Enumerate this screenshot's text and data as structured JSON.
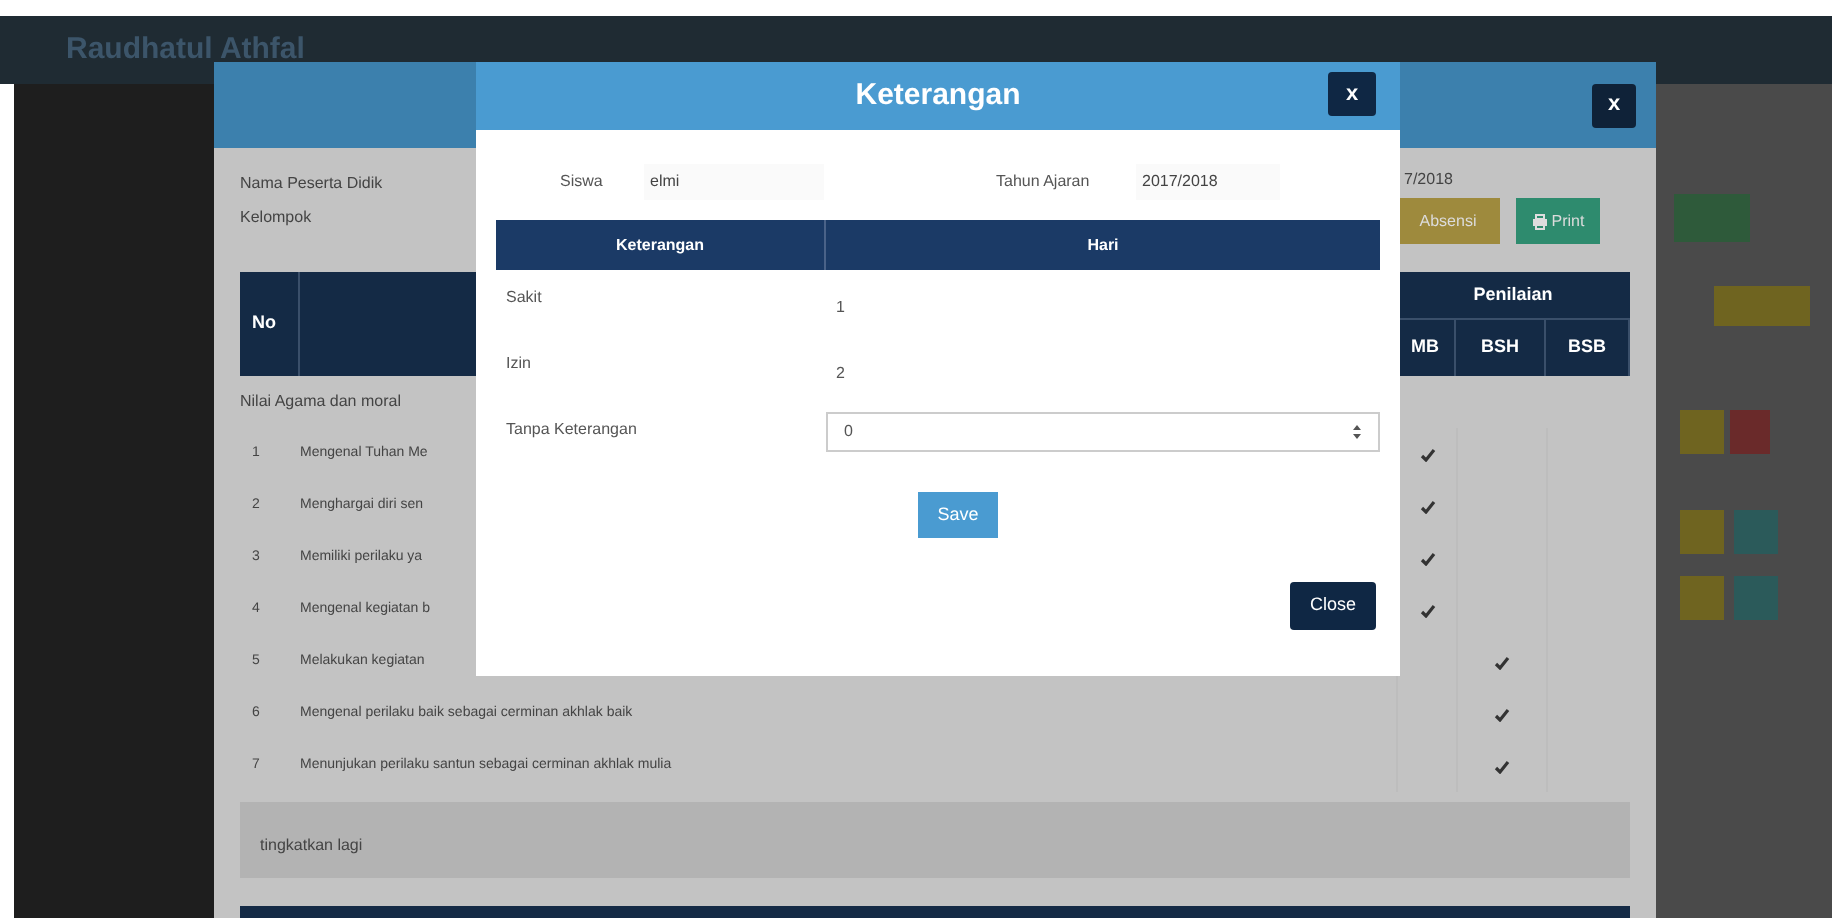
{
  "app": {
    "brand": "Raudhatul Athfal"
  },
  "report_modal": {
    "student_label": "Nama Peserta Didik",
    "group_label": "Kelompok",
    "year_fragment": "7/2018",
    "buttons": [
      {
        "kind": "attendance",
        "label": "Absensi"
      },
      {
        "kind": "print",
        "label": "Print"
      }
    ],
    "table": {
      "no_header": "No",
      "rating_group": "Penilaian",
      "rating_columns": [
        "MB",
        "BSH",
        "BSB"
      ],
      "section": "Nilai Agama dan moral",
      "rows": [
        {
          "no": "1",
          "text": "Mengenal Tuhan Me",
          "checks": [
            true,
            false,
            false
          ]
        },
        {
          "no": "2",
          "text": "Menghargai diri sen",
          "checks": [
            true,
            false,
            false
          ]
        },
        {
          "no": "3",
          "text": "Memiliki perilaku ya",
          "checks": [
            true,
            false,
            false
          ]
        },
        {
          "no": "4",
          "text": "Mengenal kegiatan b",
          "checks": [
            true,
            false,
            false
          ]
        },
        {
          "no": "5",
          "text": "Melakukan kegiatan",
          "checks": [
            false,
            true,
            false
          ]
        },
        {
          "no": "6",
          "text": "Mengenal perilaku baik sebagai cerminan akhlak baik",
          "checks": [
            false,
            true,
            false
          ]
        },
        {
          "no": "7",
          "text": "Menunjukan perilaku santun sebagai cerminan akhlak mulia",
          "checks": [
            false,
            true,
            false
          ]
        }
      ]
    },
    "note": "tingkatkan lagi",
    "close": "x"
  },
  "keterangan_modal": {
    "title": "Keterangan",
    "close_icon": "x",
    "student_label": "Siswa",
    "student_value": "elmi",
    "year_label": "Tahun Ajaran",
    "year_value": "2017/2018",
    "columns": [
      "Keterangan",
      "Hari"
    ],
    "rows": [
      {
        "kind": "text",
        "label": "Sakit",
        "value": "1"
      },
      {
        "kind": "text",
        "label": "Izin",
        "value": "2"
      },
      {
        "kind": "select",
        "label": "Tanpa Keterangan",
        "value": "0"
      }
    ],
    "save": "Save",
    "close": "Close"
  }
}
